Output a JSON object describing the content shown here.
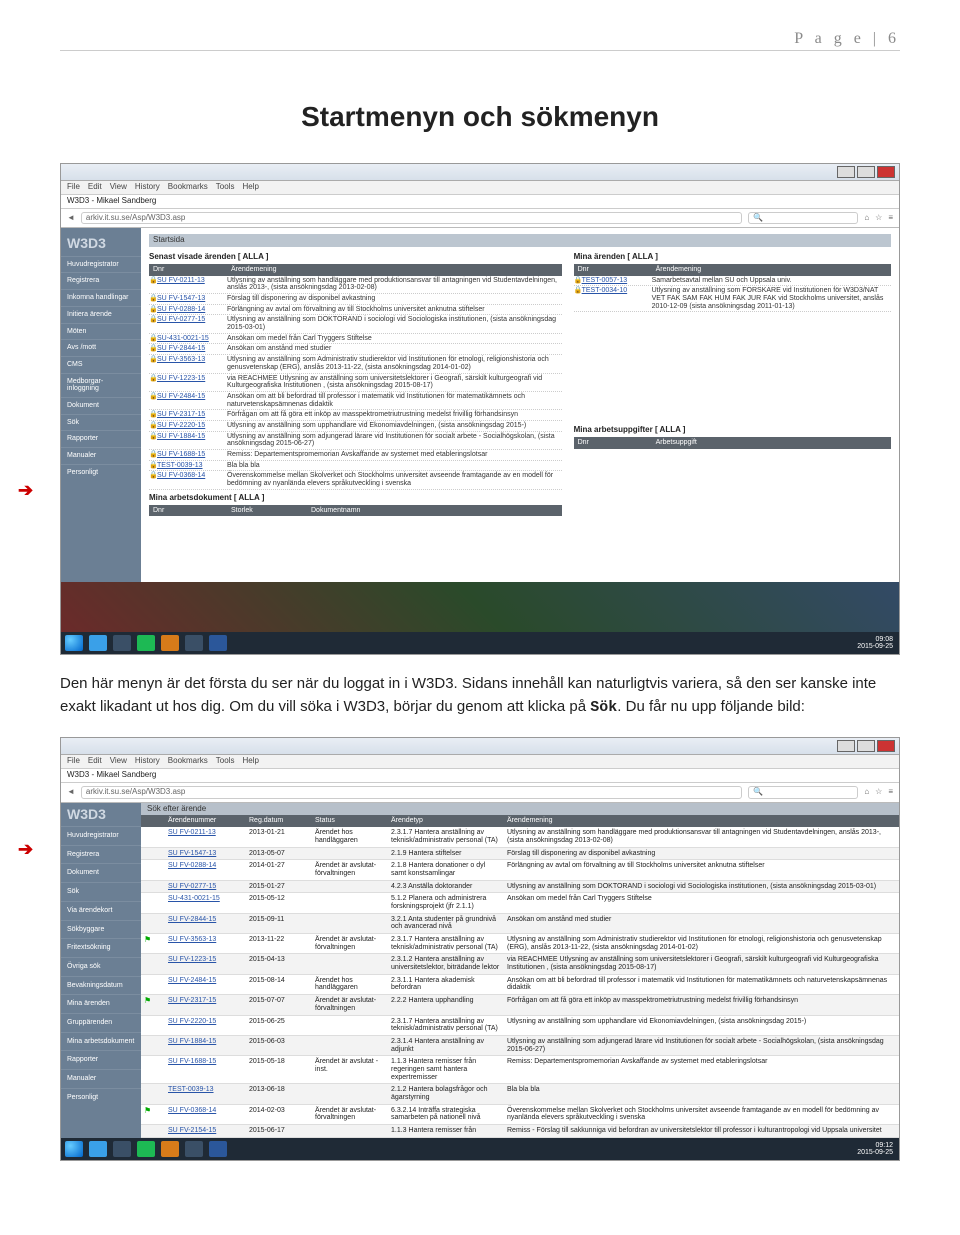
{
  "page_header": "P a g e  | 6",
  "title": "Startmenyn och sökmenyn",
  "paragraph_parts": {
    "p1": "Den här menyn är det första du ser när du loggat in i W3D3. Sidans innehåll kan naturligtvis variera, så den ser kanske inte exakt likadant ut hos dig. Om du vill söka i W3D3, börjar du genom att klicka på ",
    "sok": "Sök",
    "p2": ". Du får nu upp följande bild:"
  },
  "ff_menu": [
    "File",
    "Edit",
    "View",
    "History",
    "Bookmarks",
    "Tools",
    "Help"
  ],
  "tab_title": "W3D3 - Mikael Sandberg",
  "url_text": "arkiv.it.su.se/Asp/W3D3.asp",
  "search_placeholder": "Search",
  "app_logo": "W3D3",
  "sidebar1": [
    "Huvudregistrator",
    "Registrera",
    "Inkomna handlingar",
    "Initiera ärende",
    "Möten",
    "Avs /mott",
    "CMS",
    "Medborgar-inloggning",
    "Dokument",
    "Sök",
    "Rapporter",
    "Manualer",
    "Personligt"
  ],
  "start_label": "Startsida",
  "sect_left": "Senast visade ärenden [ ALLA ]",
  "sect_right_top": "Mina ärenden [ ALLA ]",
  "sect_left2": "Mina arbetsdokument [ ALLA ]",
  "sect_right2": "Mina arbetsuppgifter [ ALLA ]",
  "col_dnr": "Dnr",
  "col_ar": "Ärendemening",
  "col_storlek": "Storlek",
  "col_doknamn": "Dokumentnamn",
  "col_arbets": "Arbetsuppgift",
  "cases_left": [
    {
      "dnr": "SU FV-0211-13",
      "desc": "Utlysning av anställning som handläggare med produktionsansvar till antagningen vid Studentavdelningen, anslås 2013-, (sista ansökningsdag 2013-02-08)"
    },
    {
      "dnr": "SU FV-1547-13",
      "desc": "Förslag till disponering av disponibel avkastning"
    },
    {
      "dnr": "SU FV-0288-14",
      "desc": "Förlängning av avtal om förvaltning av till Stockholms universitet anknutna stiftelser"
    },
    {
      "dnr": "SU FV-0277-15",
      "desc": "Utlysning av anställning som DOKTORAND i sociologi vid Sociologiska institutionen, (sista ansökningsdag 2015-03-01)"
    },
    {
      "dnr": "SU-431-0021-15",
      "desc": "Ansökan om medel från Carl Tryggers Stiftelse"
    },
    {
      "dnr": "SU FV-2844-15",
      "desc": "Ansökan om anstånd med studier"
    },
    {
      "dnr": "SU FV-3563-13",
      "desc": "Utlysning av anställning som Administrativ studierektor vid Institutionen för etnologi, religionshistoria och genusvetenskap (ERG), anslås 2013-11-22, (sista ansökningsdag 2014-01-02)"
    },
    {
      "dnr": "SU FV-1223-15",
      "desc": "via REACHMEE Utlysning av anställning som universitetslektorer i Geografi, särskilt kulturgeografi vid Kulturgeografiska Institutionen , (sista ansökningsdag 2015-08-17)"
    },
    {
      "dnr": "SU FV-2484-15",
      "desc": "Ansökan om att bli befordrad till professor i matematik vid Institutionen för matematikämnets och naturvetenskapsämnenas didaktik"
    },
    {
      "dnr": "SU FV-2317-15",
      "desc": "Förfrågan om att få göra ett inköp av masspektrometriutrustning medelst frivillig förhandsinsyn"
    },
    {
      "dnr": "SU FV-2220-15",
      "desc": "Utlysning av anställning som upphandlare vid Ekonomiavdelningen, (sista ansökningsdag 2015-)"
    },
    {
      "dnr": "SU FV-1884-15",
      "desc": "Utlysning av anställning som adjungerad lärare vid Institutionen för socialt arbete - Socialhögskolan, (sista ansökningsdag 2015-06-27)"
    },
    {
      "dnr": "SU FV-1688-15",
      "desc": "Remiss: Departementspromemorian Avskaffande av systemet med etableringslotsar"
    },
    {
      "dnr": "TEST-0039-13",
      "desc": "Bla bla bla"
    },
    {
      "dnr": "SU FV-0368-14",
      "desc": "Överenskommelse mellan Skolverket och Stockholms universitet avseende framtagande av en modell för bedömning av nyanlända elevers språkutveckling i svenska"
    }
  ],
  "cases_right": [
    {
      "dnr": "TEST-0057-13",
      "desc": "Samarbetsavtal mellan SU och Uppsala univ."
    },
    {
      "dnr": "TEST-0034-10",
      "desc": "Utlysning av anställning som FORSKARE vid Institutionen för W3D3/NAT VET FAK SAM FAK HUM FAK JUR FAK vid Stockholms universitet, anslås 2010-12-09 (sista ansökningsdag 2011-01-13)"
    }
  ],
  "clock1": {
    "t": "09:08",
    "d": "2015-09-25"
  },
  "search_header": "Sök efter ärende",
  "grid_cols": {
    "nr": "Ärendenummer",
    "reg": "Reg.datum",
    "stat": "Status",
    "typ": "Ärendetyp",
    "mening": "Ärendemening"
  },
  "sidebar2": [
    "Huvudregistrator",
    "Registrera",
    "Dokument",
    "Sök",
    "Via ärendekort",
    "Sökbyggare",
    "Fritextsökning",
    "Övriga sök",
    "Bevakningsdatum",
    "Mina ärenden",
    "Gruppärenden",
    "Mina arbetsdokument",
    "Rapporter",
    "Manualer",
    "Personligt"
  ],
  "grid_rows": [
    {
      "dnr": "SU FV-0211-13",
      "date": "2013-01-21",
      "stat": "Ärendet hos handläggaren",
      "typ": "2.3.1.7 Hantera anställning av teknisk/administrativ personal (TA)",
      "desc": "Utlysning av anställning som handläggare med produktionsansvar till antagningen vid Studentavdelningen, anslås 2013-, (sista ansökningsdag 2013-02-08)",
      "flag": false
    },
    {
      "dnr": "SU FV-1547-13",
      "date": "2013-05-07",
      "stat": "",
      "typ": "2.1.9 Hantera stiftelser",
      "desc": "Förslag till disponering av disponibel avkastning",
      "flag": false
    },
    {
      "dnr": "SU FV-0288-14",
      "date": "2014-01-27",
      "stat": "Ärendet är avslutat-förvaltningen",
      "typ": "2.1.8 Hantera donationer o dyl samt konstsamlingar",
      "desc": "Förlängning av avtal om förvaltning av till Stockholms universitet anknutna stiftelser",
      "flag": false
    },
    {
      "dnr": "SU FV-0277-15",
      "date": "2015-01-27",
      "stat": "",
      "typ": "4.2.3 Anställa doktorander",
      "desc": "Utlysning av anställning som DOKTORAND i sociologi vid Sociologiska institutionen, (sista ansökningsdag 2015-03-01)",
      "flag": false
    },
    {
      "dnr": "SU-431-0021-15",
      "date": "2015-05-12",
      "stat": "",
      "typ": "5.1.2 Planera och administrera forskningsprojekt (jfr 2.1.1)",
      "desc": "Ansökan om medel från Carl Tryggers Stiftelse",
      "flag": false
    },
    {
      "dnr": "SU FV-2844-15",
      "date": "2015-09-11",
      "stat": "",
      "typ": "3.2.1 Anta studenter på grundnivå och avancerad nivå",
      "desc": "Ansökan om anstånd med studier",
      "flag": false
    },
    {
      "dnr": "SU FV-3563-13",
      "date": "2013-11-22",
      "stat": "Ärendet är avslutat-förvaltningen",
      "typ": "2.3.1.7 Hantera anställning av teknisk/administrativ personal (TA)",
      "desc": "Utlysning av anställning som Administrativ studierektor vid Institutionen för etnologi, religionshistoria och genusvetenskap (ERG), anslås 2013-11-22, (sista ansökningsdag 2014-01-02)",
      "flag": true
    },
    {
      "dnr": "SU FV-1223-15",
      "date": "2015-04-13",
      "stat": "",
      "typ": "2.3.1.2 Hantera anställning av universitetslektor, biträdande lektor",
      "desc": "via REACHMEE Utlysning av anställning som universitetslektorer i Geografi, särskilt kulturgeografi vid Kulturgeografiska Institutionen , (sista ansökningsdag 2015-08-17)",
      "flag": false
    },
    {
      "dnr": "SU FV-2484-15",
      "date": "2015-08-14",
      "stat": "Ärendet hos handläggaren",
      "typ": "2.3.1.1 Hantera akademisk befordran",
      "desc": "Ansökan om att bli befordrad till professor i matematik vid Institutionen för matematikämnets och naturvetenskapsämnenas didaktik",
      "flag": false
    },
    {
      "dnr": "SU FV-2317-15",
      "date": "2015-07-07",
      "stat": "Ärendet är avslutat-förvaltningen",
      "typ": "2.2.2 Hantera upphandling",
      "desc": "Förfrågan om att få göra ett inköp av masspektrometriutrustning medelst frivillig förhandsinsyn",
      "flag": true
    },
    {
      "dnr": "SU FV-2220-15",
      "date": "2015-06-25",
      "stat": "",
      "typ": "2.3.1.7 Hantera anställning av teknisk/administrativ personal (TA)",
      "desc": "Utlysning av anställning som upphandlare vid Ekonomiavdelningen, (sista ansökningsdag 2015-)",
      "flag": false
    },
    {
      "dnr": "SU FV-1884-15",
      "date": "2015-06-03",
      "stat": "",
      "typ": "2.3.1.4 Hantera anställning av adjunkt",
      "desc": "Utlysning av anställning som adjungerad lärare vid Institutionen för socialt arbete - Socialhögskolan, (sista ansökningsdag 2015-06-27)",
      "flag": false
    },
    {
      "dnr": "SU FV-1688-15",
      "date": "2015-05-18",
      "stat": "Ärendet är avslutat - inst.",
      "typ": "1.1.3 Hantera remisser från regeringen samt hantera expertremisser",
      "desc": "Remiss: Departementspromemorian Avskaffande av systemet med etableringslotsar",
      "flag": false
    },
    {
      "dnr": "TEST-0039-13",
      "date": "2013-06-18",
      "stat": "",
      "typ": "2.1.2 Hantera bolagsfrågor och ägarstyrning",
      "desc": "Bla bla bla",
      "flag": false
    },
    {
      "dnr": "SU FV-0368-14",
      "date": "2014-02-03",
      "stat": "Ärendet är avslutat-förvaltningen",
      "typ": "6.3.2.14 Inträffa strategiska samarbeten på nationell nivå",
      "desc": "Överenskommelse mellan Skolverket och Stockholms universitet avseende framtagande av en modell för bedömning av nyanlända elevers språkutveckling i svenska",
      "flag": true
    },
    {
      "dnr": "SU FV-2154-15",
      "date": "2015-06-17",
      "stat": "",
      "typ": "1.1.3 Hantera remisser från",
      "desc": "Remiss - Förslag till sakkunniga vid befordran av universitetslektor till professor i kulturantropologi vid Uppsala universitet",
      "flag": false
    }
  ],
  "clock2": {
    "t": "09:12",
    "d": "2015-09-25"
  }
}
